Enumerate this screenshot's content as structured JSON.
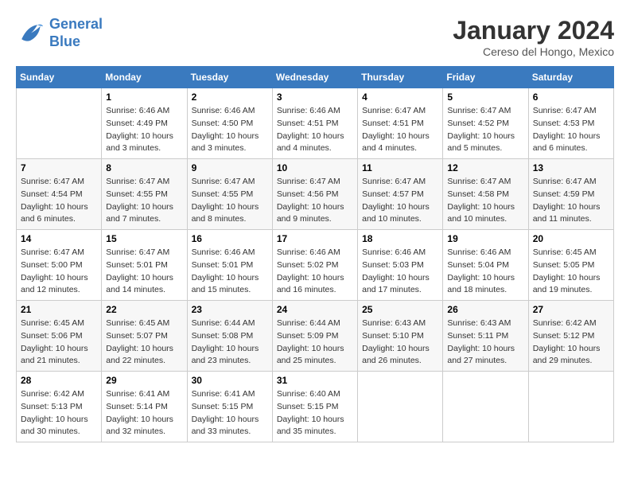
{
  "header": {
    "logo_line1": "General",
    "logo_line2": "Blue",
    "month_title": "January 2024",
    "subtitle": "Cereso del Hongo, Mexico"
  },
  "weekdays": [
    "Sunday",
    "Monday",
    "Tuesday",
    "Wednesday",
    "Thursday",
    "Friday",
    "Saturday"
  ],
  "weeks": [
    [
      {
        "day": "",
        "info": ""
      },
      {
        "day": "1",
        "info": "Sunrise: 6:46 AM\nSunset: 4:49 PM\nDaylight: 10 hours\nand 3 minutes."
      },
      {
        "day": "2",
        "info": "Sunrise: 6:46 AM\nSunset: 4:50 PM\nDaylight: 10 hours\nand 3 minutes."
      },
      {
        "day": "3",
        "info": "Sunrise: 6:46 AM\nSunset: 4:51 PM\nDaylight: 10 hours\nand 4 minutes."
      },
      {
        "day": "4",
        "info": "Sunrise: 6:47 AM\nSunset: 4:51 PM\nDaylight: 10 hours\nand 4 minutes."
      },
      {
        "day": "5",
        "info": "Sunrise: 6:47 AM\nSunset: 4:52 PM\nDaylight: 10 hours\nand 5 minutes."
      },
      {
        "day": "6",
        "info": "Sunrise: 6:47 AM\nSunset: 4:53 PM\nDaylight: 10 hours\nand 6 minutes."
      }
    ],
    [
      {
        "day": "7",
        "info": "Sunrise: 6:47 AM\nSunset: 4:54 PM\nDaylight: 10 hours\nand 6 minutes."
      },
      {
        "day": "8",
        "info": "Sunrise: 6:47 AM\nSunset: 4:55 PM\nDaylight: 10 hours\nand 7 minutes."
      },
      {
        "day": "9",
        "info": "Sunrise: 6:47 AM\nSunset: 4:55 PM\nDaylight: 10 hours\nand 8 minutes."
      },
      {
        "day": "10",
        "info": "Sunrise: 6:47 AM\nSunset: 4:56 PM\nDaylight: 10 hours\nand 9 minutes."
      },
      {
        "day": "11",
        "info": "Sunrise: 6:47 AM\nSunset: 4:57 PM\nDaylight: 10 hours\nand 10 minutes."
      },
      {
        "day": "12",
        "info": "Sunrise: 6:47 AM\nSunset: 4:58 PM\nDaylight: 10 hours\nand 10 minutes."
      },
      {
        "day": "13",
        "info": "Sunrise: 6:47 AM\nSunset: 4:59 PM\nDaylight: 10 hours\nand 11 minutes."
      }
    ],
    [
      {
        "day": "14",
        "info": "Sunrise: 6:47 AM\nSunset: 5:00 PM\nDaylight: 10 hours\nand 12 minutes."
      },
      {
        "day": "15",
        "info": "Sunrise: 6:47 AM\nSunset: 5:01 PM\nDaylight: 10 hours\nand 14 minutes."
      },
      {
        "day": "16",
        "info": "Sunrise: 6:46 AM\nSunset: 5:01 PM\nDaylight: 10 hours\nand 15 minutes."
      },
      {
        "day": "17",
        "info": "Sunrise: 6:46 AM\nSunset: 5:02 PM\nDaylight: 10 hours\nand 16 minutes."
      },
      {
        "day": "18",
        "info": "Sunrise: 6:46 AM\nSunset: 5:03 PM\nDaylight: 10 hours\nand 17 minutes."
      },
      {
        "day": "19",
        "info": "Sunrise: 6:46 AM\nSunset: 5:04 PM\nDaylight: 10 hours\nand 18 minutes."
      },
      {
        "day": "20",
        "info": "Sunrise: 6:45 AM\nSunset: 5:05 PM\nDaylight: 10 hours\nand 19 minutes."
      }
    ],
    [
      {
        "day": "21",
        "info": "Sunrise: 6:45 AM\nSunset: 5:06 PM\nDaylight: 10 hours\nand 21 minutes."
      },
      {
        "day": "22",
        "info": "Sunrise: 6:45 AM\nSunset: 5:07 PM\nDaylight: 10 hours\nand 22 minutes."
      },
      {
        "day": "23",
        "info": "Sunrise: 6:44 AM\nSunset: 5:08 PM\nDaylight: 10 hours\nand 23 minutes."
      },
      {
        "day": "24",
        "info": "Sunrise: 6:44 AM\nSunset: 5:09 PM\nDaylight: 10 hours\nand 25 minutes."
      },
      {
        "day": "25",
        "info": "Sunrise: 6:43 AM\nSunset: 5:10 PM\nDaylight: 10 hours\nand 26 minutes."
      },
      {
        "day": "26",
        "info": "Sunrise: 6:43 AM\nSunset: 5:11 PM\nDaylight: 10 hours\nand 27 minutes."
      },
      {
        "day": "27",
        "info": "Sunrise: 6:42 AM\nSunset: 5:12 PM\nDaylight: 10 hours\nand 29 minutes."
      }
    ],
    [
      {
        "day": "28",
        "info": "Sunrise: 6:42 AM\nSunset: 5:13 PM\nDaylight: 10 hours\nand 30 minutes."
      },
      {
        "day": "29",
        "info": "Sunrise: 6:41 AM\nSunset: 5:14 PM\nDaylight: 10 hours\nand 32 minutes."
      },
      {
        "day": "30",
        "info": "Sunrise: 6:41 AM\nSunset: 5:15 PM\nDaylight: 10 hours\nand 33 minutes."
      },
      {
        "day": "31",
        "info": "Sunrise: 6:40 AM\nSunset: 5:15 PM\nDaylight: 10 hours\nand 35 minutes."
      },
      {
        "day": "",
        "info": ""
      },
      {
        "day": "",
        "info": ""
      },
      {
        "day": "",
        "info": ""
      }
    ]
  ]
}
